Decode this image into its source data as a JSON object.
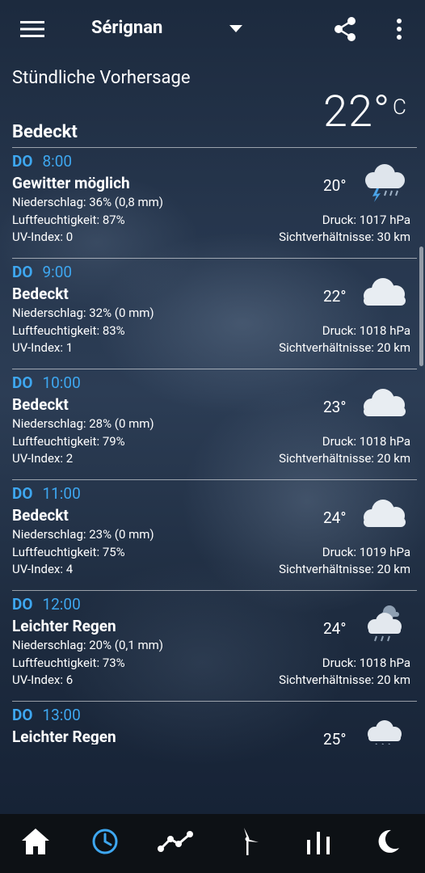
{
  "header": {
    "city": "Sérignan",
    "menu_icon": "hamburger-menu-icon",
    "dropdown_icon": "dropdown-arrow-icon",
    "share_icon": "share-icon",
    "more_icon": "more-vert-icon"
  },
  "section_title": "Stündliche Vorhersage",
  "current": {
    "temp": "22°",
    "unit": "C",
    "condition": "Bedeckt"
  },
  "accent_color": "#3ea7f0",
  "hours": [
    {
      "day": "DO",
      "time": "8:00",
      "condition": "Gewitter möglich",
      "temp": "20°",
      "icon": "thunderstorm-cloud-icon",
      "precip": "Niederschlag: 36% (0,8 mm)",
      "humidity": "Luftfeuchtigkeit: 87%",
      "uv": "UV-Index: 0",
      "pressure": "Druck: 1017 hPa",
      "visibility": "Sichtverhältnisse: 30 km"
    },
    {
      "day": "DO",
      "time": "9:00",
      "condition": "Bedeckt",
      "temp": "22°",
      "icon": "overcast-cloud-icon",
      "precip": "Niederschlag: 32% (0 mm)",
      "humidity": "Luftfeuchtigkeit: 83%",
      "uv": "UV-Index: 1",
      "pressure": "Druck: 1018 hPa",
      "visibility": "Sichtverhältnisse: 20 km"
    },
    {
      "day": "DO",
      "time": "10:00",
      "condition": "Bedeckt",
      "temp": "23°",
      "icon": "overcast-cloud-icon",
      "precip": "Niederschlag: 28% (0 mm)",
      "humidity": "Luftfeuchtigkeit: 79%",
      "uv": "UV-Index: 2",
      "pressure": "Druck: 1018 hPa",
      "visibility": "Sichtverhältnisse: 20 km"
    },
    {
      "day": "DO",
      "time": "11:00",
      "condition": "Bedeckt",
      "temp": "24°",
      "icon": "overcast-cloud-icon",
      "precip": "Niederschlag: 23% (0 mm)",
      "humidity": "Luftfeuchtigkeit: 75%",
      "uv": "UV-Index: 4",
      "pressure": "Druck: 1019 hPa",
      "visibility": "Sichtverhältnisse: 20 km"
    },
    {
      "day": "DO",
      "time": "12:00",
      "condition": "Leichter Regen",
      "temp": "24°",
      "icon": "light-rain-cloud-icon",
      "precip": "Niederschlag: 20% (0,1 mm)",
      "humidity": "Luftfeuchtigkeit: 73%",
      "uv": "UV-Index: 6",
      "pressure": "Druck: 1018 hPa",
      "visibility": "Sichtverhältnisse: 20 km"
    },
    {
      "day": "DO",
      "time": "13:00",
      "condition": "Leichter Regen",
      "temp": "25°",
      "icon": "light-rain-cloud-icon"
    }
  ],
  "bottom_nav": [
    {
      "name": "home",
      "icon": "home-icon",
      "active": false
    },
    {
      "name": "hourly",
      "icon": "clock-icon",
      "active": true
    },
    {
      "name": "chart",
      "icon": "trend-chart-icon",
      "active": false
    },
    {
      "name": "wind",
      "icon": "wind-turbine-icon",
      "active": false
    },
    {
      "name": "bars",
      "icon": "bar-chart-icon",
      "active": false
    },
    {
      "name": "moon",
      "icon": "moon-icon",
      "active": false
    }
  ]
}
